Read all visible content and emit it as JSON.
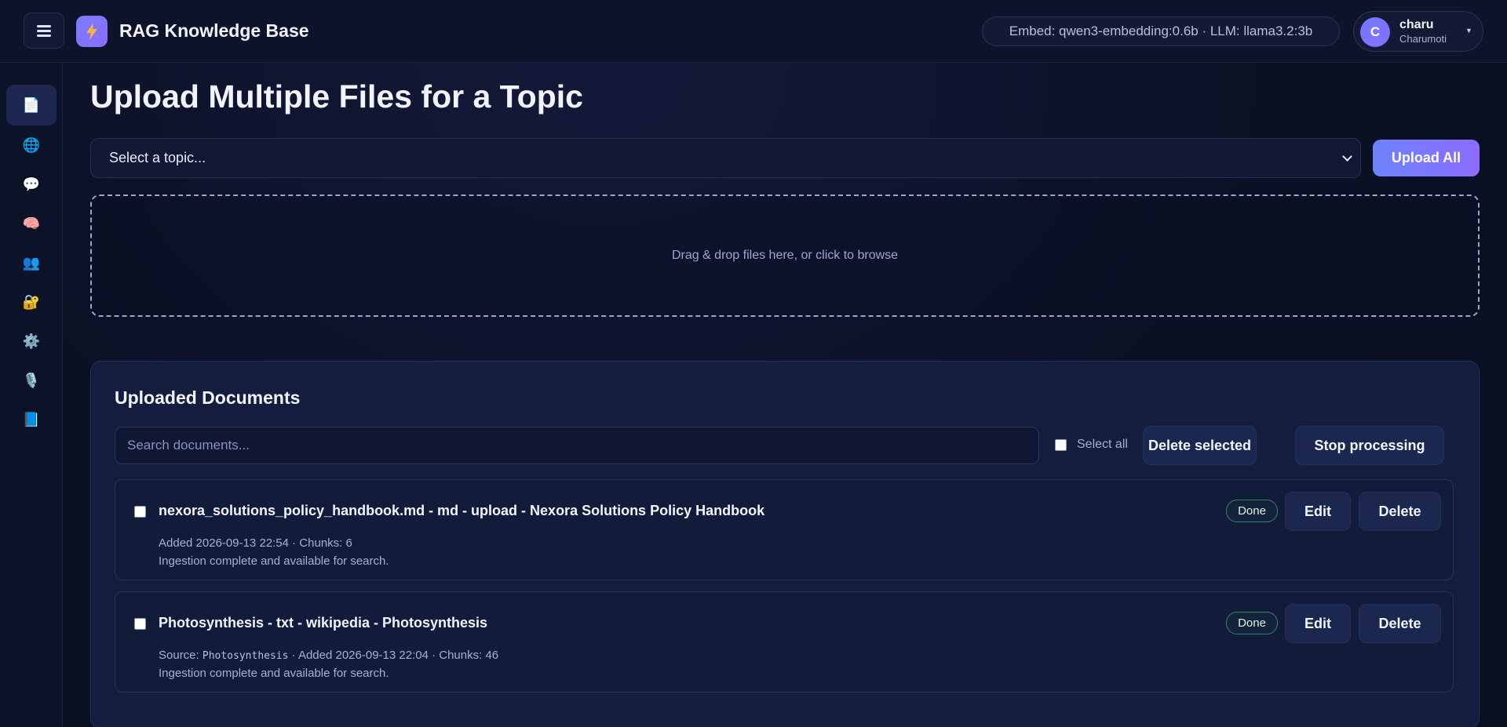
{
  "header": {
    "app_title": "RAG Knowledge Base",
    "model_info": "Embed: qwen3-embedding:0.6b · LLM: llama3.2:3b",
    "user": {
      "initial": "C",
      "name": "charu",
      "subtitle": "Charumoti"
    }
  },
  "sidebar": {
    "items": [
      {
        "icon": "document-icon",
        "glyph": "📄",
        "active": true
      },
      {
        "icon": "globe-icon",
        "glyph": "🌐",
        "active": false
      },
      {
        "icon": "chat-icon",
        "glyph": "💬",
        "active": false
      },
      {
        "icon": "brain-icon",
        "glyph": "🧠",
        "active": false
      },
      {
        "icon": "users-icon",
        "glyph": "👥",
        "active": false
      },
      {
        "icon": "lock-icon",
        "glyph": "🔐",
        "active": false
      },
      {
        "icon": "gear-icon",
        "glyph": "⚙️",
        "active": false
      },
      {
        "icon": "microphone-icon",
        "glyph": "🎙️",
        "active": false
      },
      {
        "icon": "book-icon",
        "glyph": "📘",
        "active": false
      }
    ]
  },
  "main": {
    "page_title": "Upload Multiple Files for a Topic",
    "topic_select_value": "Select a topic...",
    "upload_all_label": "Upload All",
    "dropzone_text": "Drag & drop files here, or click to browse"
  },
  "documents": {
    "title": "Uploaded Documents",
    "search_placeholder": "Search documents...",
    "select_all_label": "Select all",
    "delete_selected_label": "Delete selected",
    "stop_processing_label": "Stop processing",
    "items": [
      {
        "title": "nexora_solutions_policy_handbook.md - md - upload - Nexora Solutions Policy Handbook",
        "meta": "Added 2026-09-13 22:54 · Chunks: 6",
        "status_text": "Ingestion complete and available for search.",
        "badge": "Done",
        "edit_label": "Edit",
        "delete_label": "Delete"
      },
      {
        "title": "Photosynthesis - txt - wikipedia - Photosynthesis",
        "meta_prefix": "Source: ",
        "meta_source": "Photosynthesis",
        "meta_suffix": " · Added 2026-09-13 22:04 · Chunks: 46",
        "status_text": "Ingestion complete and available for search.",
        "badge": "Done",
        "edit_label": "Edit",
        "delete_label": "Delete"
      }
    ]
  },
  "colors": {
    "accent_start": "#6d83ff",
    "accent_end": "#8b6cff",
    "done_border": "#3a7f6b"
  }
}
